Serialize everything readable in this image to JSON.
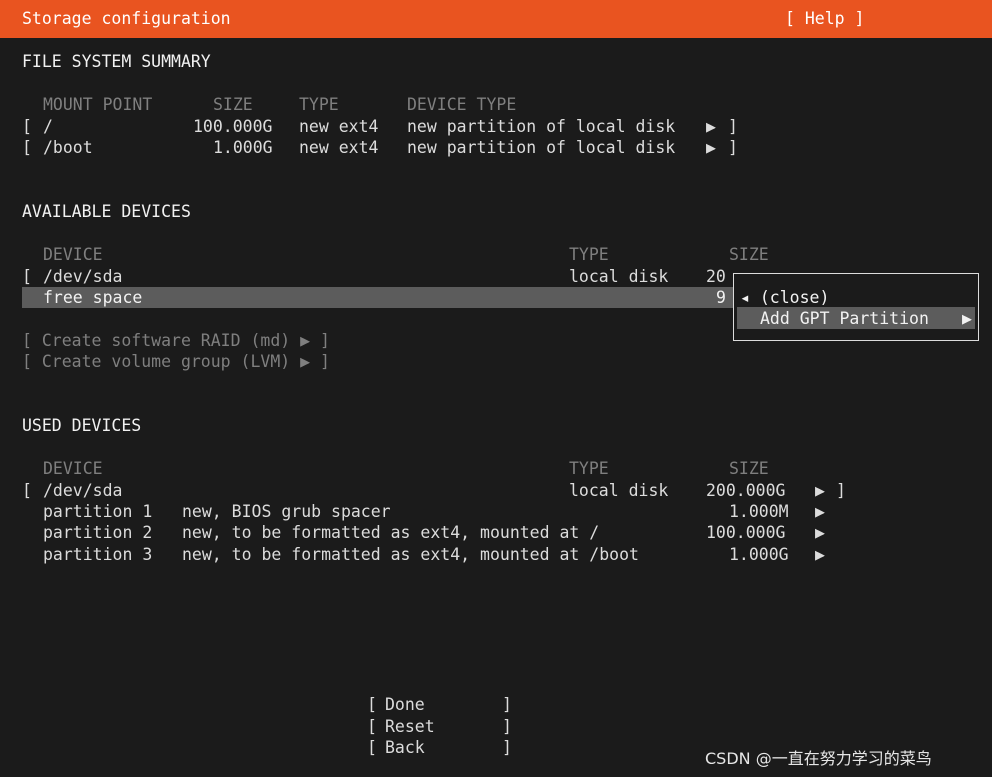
{
  "header": {
    "title": "Storage configuration",
    "help": "[ Help ]"
  },
  "fs_summary": {
    "heading": "FILE SYSTEM SUMMARY",
    "columns": {
      "mount": "MOUNT POINT",
      "size": "SIZE",
      "type": "TYPE",
      "device_type": "DEVICE TYPE"
    },
    "rows": [
      {
        "bracket": "[",
        "mount": "/",
        "size": "100.000G",
        "type": "new ext4",
        "device_type": "new partition of local disk",
        "arrow": "▶",
        "close": "]"
      },
      {
        "bracket": "[",
        "mount": "/boot",
        "size": "1.000G",
        "type": "new ext4",
        "device_type": "new partition of local disk",
        "arrow": "▶",
        "close": "]"
      }
    ]
  },
  "available": {
    "heading": "AVAILABLE DEVICES",
    "columns": {
      "device": "DEVICE",
      "type": "TYPE",
      "size": "SIZE"
    },
    "disk": {
      "bracket": "[",
      "name": "/dev/sda",
      "type": "local disk",
      "size": "20"
    },
    "free": {
      "name": "free space",
      "size": "9"
    },
    "raid": "[ Create software RAID (md) ▶ ]",
    "lvm": "[ Create volume group (LVM) ▶ ]"
  },
  "popup": {
    "close": "◂ (close)",
    "add_gpt": "Add GPT Partition",
    "add_gpt_arrow": "▶"
  },
  "used": {
    "heading": "USED DEVICES",
    "columns": {
      "device": "DEVICE",
      "type": "TYPE",
      "size": "SIZE"
    },
    "disk": {
      "bracket": "[",
      "name": "/dev/sda",
      "type": "local disk",
      "size": "200.000G",
      "arrow": "▶",
      "close": "]"
    },
    "partitions": [
      {
        "name": "partition 1",
        "desc": "new, BIOS grub spacer",
        "size": "1.000M",
        "arrow": "▶"
      },
      {
        "name": "partition 2",
        "desc": "new, to be formatted as ext4, mounted at /",
        "size": "100.000G",
        "arrow": "▶"
      },
      {
        "name": "partition 3",
        "desc": "new, to be formatted as ext4, mounted at /boot",
        "size": "1.000G",
        "arrow": "▶"
      }
    ]
  },
  "buttons": {
    "done": {
      "open": "[",
      "label": "Done",
      "close": "]"
    },
    "reset": {
      "open": "[",
      "label": "Reset",
      "close": "]"
    },
    "back": {
      "open": "[",
      "label": "Back",
      "close": "]"
    }
  },
  "watermark": "CSDN @一直在努力学习的菜鸟",
  "colors": {
    "accent": "#e95420",
    "highlight": "#5c5c5c",
    "background": "#1b1b1b"
  }
}
